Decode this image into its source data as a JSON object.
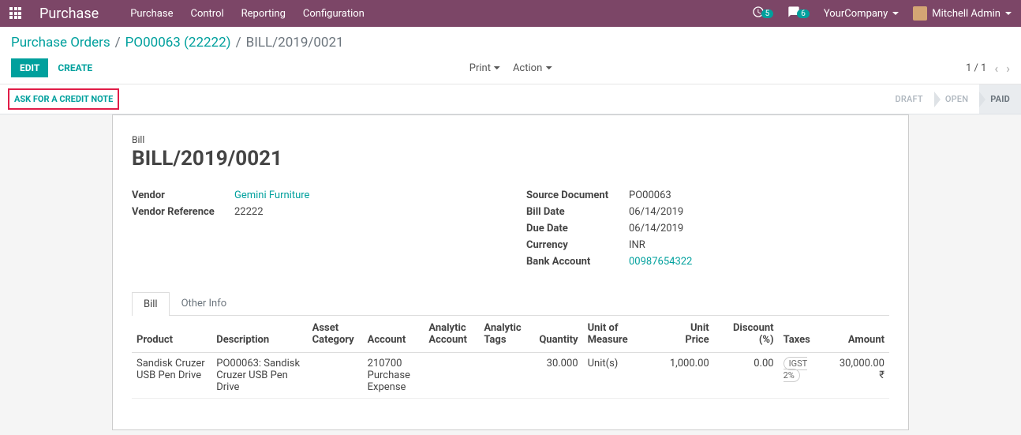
{
  "header": {
    "app_title": "Purchase",
    "menus": [
      "Purchase",
      "Control",
      "Reporting",
      "Configuration"
    ],
    "clock_badge": "5",
    "chat_badge": "6",
    "company": "YourCompany",
    "user": "Mitchell Admin"
  },
  "breadcrumb": {
    "root": "Purchase Orders",
    "po": "PO00063 (22222)",
    "current": "BILL/2019/0021"
  },
  "control": {
    "edit": "EDIT",
    "create": "CREATE",
    "print": "Print",
    "action": "Action",
    "pager": "1 / 1"
  },
  "statusbar": {
    "credit_note": "ASK FOR A CREDIT NOTE",
    "states": [
      "DRAFT",
      "OPEN",
      "PAID"
    ]
  },
  "form": {
    "doc_type": "Bill",
    "doc_title": "BILL/2019/0021",
    "left": {
      "vendor_label": "Vendor",
      "vendor_value": "Gemini Furniture",
      "vendor_ref_label": "Vendor Reference",
      "vendor_ref_value": "22222"
    },
    "right": {
      "src_label": "Source Document",
      "src_value": "PO00063",
      "bill_date_label": "Bill Date",
      "bill_date_value": "06/14/2019",
      "due_date_label": "Due Date",
      "due_date_value": "06/14/2019",
      "currency_label": "Currency",
      "currency_value": "INR",
      "bank_label": "Bank Account",
      "bank_value": "00987654322"
    },
    "tabs": [
      "Bill",
      "Other Info"
    ],
    "columns": {
      "product": "Product",
      "description": "Description",
      "asset": "Asset Category",
      "account": "Account",
      "analytic_account": "Analytic Account",
      "analytic_tags": "Analytic Tags",
      "quantity": "Quantity",
      "uom": "Unit of Measure",
      "unit_price": "Unit Price",
      "discount": "Discount (%)",
      "taxes": "Taxes",
      "amount": "Amount"
    },
    "lines": [
      {
        "product": "Sandisk Cruzer USB Pen Drive",
        "description": "PO00063: Sandisk Cruzer USB Pen Drive",
        "asset": "",
        "account": "210700 Purchase Expense",
        "analytic_account": "",
        "analytic_tags": "",
        "quantity": "30.000",
        "uom": "Unit(s)",
        "unit_price": "1,000.00",
        "discount": "0.00",
        "tax": "IGST 2%",
        "amount": "30,000.00 ₹"
      }
    ]
  }
}
